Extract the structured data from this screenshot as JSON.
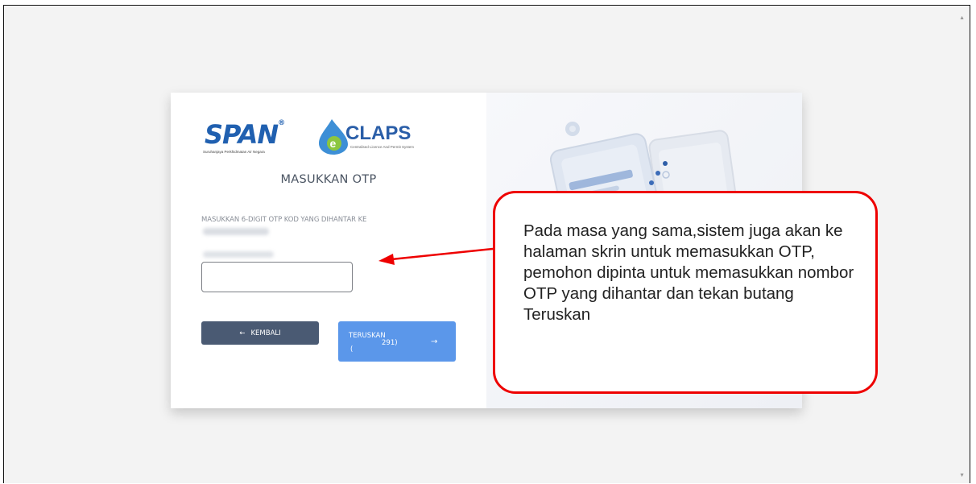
{
  "logos": {
    "span_text": "SPAN",
    "span_tm": "®",
    "span_subtitle": "Suruhanjaya Perkhidmatan Air Negara",
    "eclaps_text": "CLAPS",
    "eclaps_subtitle": "Centralised Licence And Permit System"
  },
  "form": {
    "title": "MASUKKAN OTP",
    "instruction": "MASUKKAN 6-DIGIT OTP KOD YANG DIHANTAR KE",
    "otp_value": ""
  },
  "buttons": {
    "back_icon": "←",
    "back_label": "KEMBALI",
    "next_label": "TERUSKAN",
    "next_count": "291)",
    "next_paren": "(",
    "next_icon": "→"
  },
  "callout": {
    "text": "Pada masa yang sama,sistem juga akan ke halaman skrin untuk memasukkan OTP, pemohon dipinta untuk memasukkan nombor OTP yang dihantar dan tekan butang Teruskan"
  },
  "colors": {
    "brand_blue": "#2060b0",
    "back_button": "#4a5a73",
    "next_button": "#5b97ea",
    "callout_border": "#ee0000"
  },
  "icons": {
    "back": "arrow-left-icon",
    "next": "arrow-right-icon",
    "scroll_up": "scroll-up-icon",
    "scroll_down": "scroll-down-icon"
  }
}
